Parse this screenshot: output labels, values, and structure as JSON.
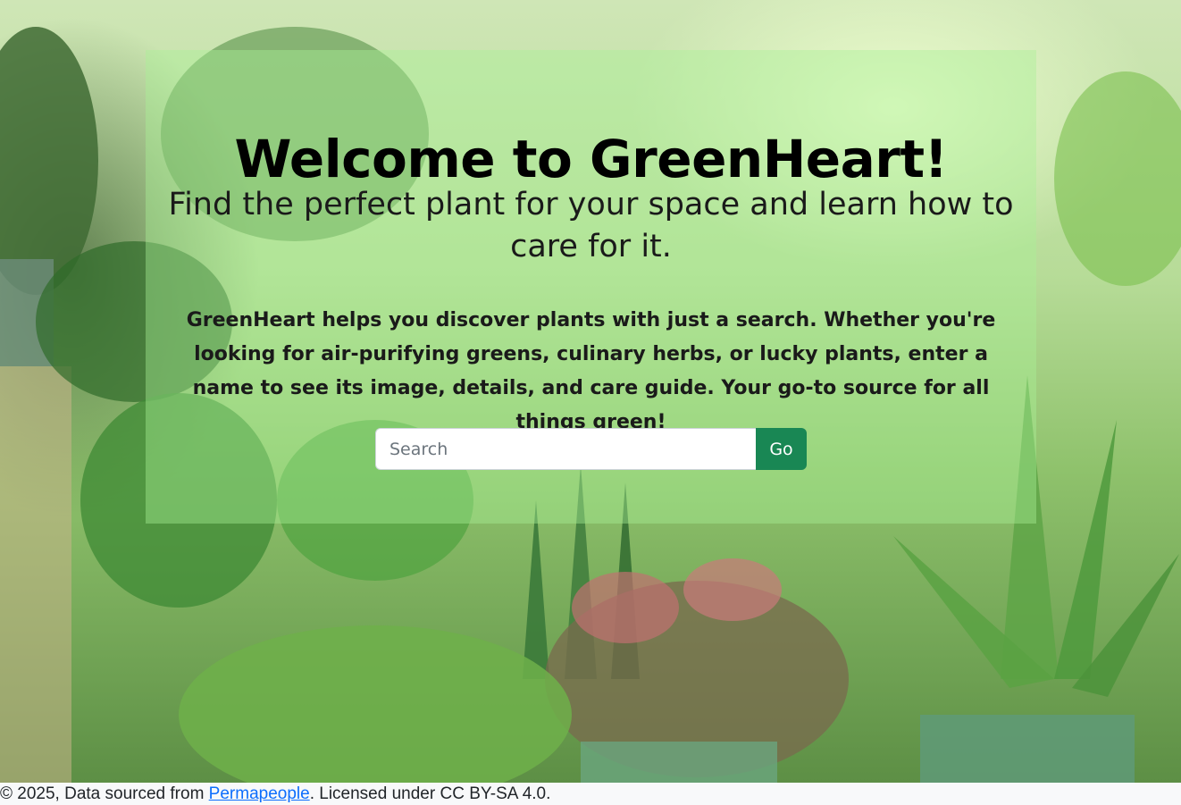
{
  "hero": {
    "title": "Welcome to GreenHeart!",
    "subtitle": "Find the perfect plant for your space and learn how to care for it.",
    "description": "GreenHeart helps you discover plants with just a search. Whether you're looking for air-purifying greens, culinary herbs, or lucky plants, enter a name to see its image, details, and care guide. Your go-to source for all things green!"
  },
  "search": {
    "placeholder": "Search",
    "value": "",
    "button_label": "Go"
  },
  "footer": {
    "prefix": "© 2025, Data sourced from ",
    "link_label": "Permapeople",
    "suffix": ". Licensed under CC BY-SA 4.0."
  },
  "colors": {
    "button": "#198754",
    "link": "#0d6efd",
    "footer_bg": "#f8f9fa",
    "overlay": "rgba(170,240,150,0.42)"
  }
}
